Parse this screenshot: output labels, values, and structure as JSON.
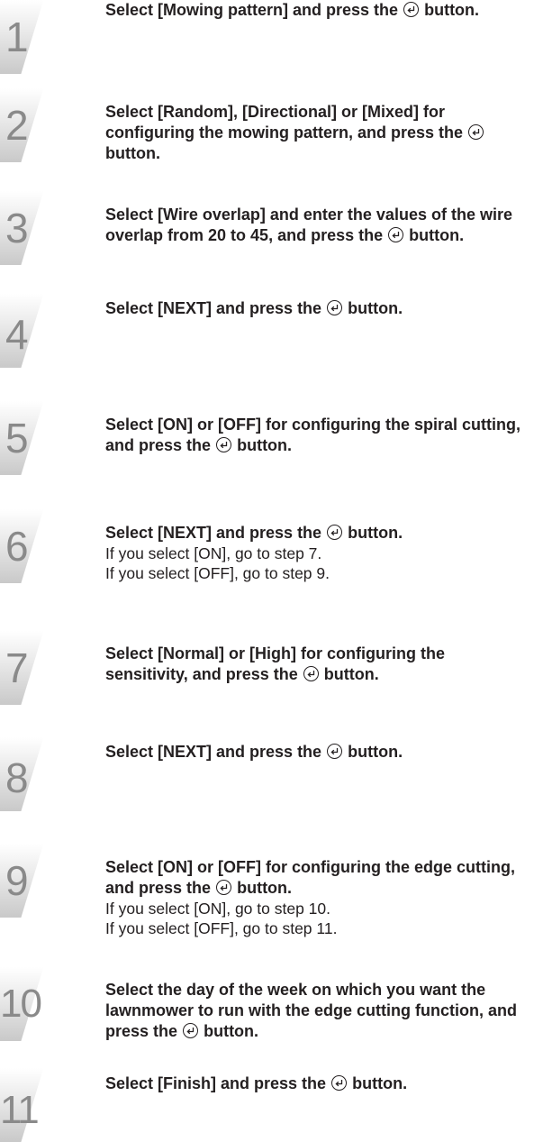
{
  "steps": [
    {
      "number": "1",
      "bold_before": "Select [Mowing pattern] and press the",
      "bold_after": "button.",
      "lines": []
    },
    {
      "number": "2",
      "bold_before": "Select [Random], [Directional] or [Mixed] for configuring the mowing pattern, and press the",
      "bold_after": "button.",
      "lines": []
    },
    {
      "number": "3",
      "bold_before": "Select [Wire overlap] and enter the values of the wire overlap from 20 to 45, and press the",
      "bold_after": "button.",
      "lines": []
    },
    {
      "number": "4",
      "bold_before": "Select [NEXT] and press the",
      "bold_after": "button.",
      "lines": []
    },
    {
      "number": "5",
      "bold_before": "Select [ON] or [OFF] for configuring the spiral cutting, and press the",
      "bold_after": "button.",
      "lines": []
    },
    {
      "number": "6",
      "bold_before": "Select [NEXT] and press the",
      "bold_after": "button.",
      "lines": [
        "If you select [ON], go to step 7.",
        "If you select [OFF], go to step 9."
      ]
    },
    {
      "number": "7",
      "bold_before": "Select [Normal] or [High] for configuring the sensitivity, and press the",
      "bold_after": "button.",
      "lines": []
    },
    {
      "number": "8",
      "bold_before": "Select [NEXT] and press the",
      "bold_after": "button.",
      "lines": []
    },
    {
      "number": "9",
      "bold_before": "Select [ON] or [OFF] for configuring the edge cutting, and press the",
      "bold_after": "button.",
      "lines": [
        "If you select [ON], go to step 10.",
        "If you select [OFF], go to step 11."
      ]
    },
    {
      "number": "10",
      "bold_before": "Select the day of the week on which you want the lawnmower to run with the edge cutting function, and press the",
      "bold_after": "button.",
      "lines": []
    },
    {
      "number": "11",
      "bold_before": "Select [Finish] and press the",
      "bold_after": "button.",
      "lines": []
    }
  ],
  "icons": {
    "enter": "enter-button-icon"
  }
}
